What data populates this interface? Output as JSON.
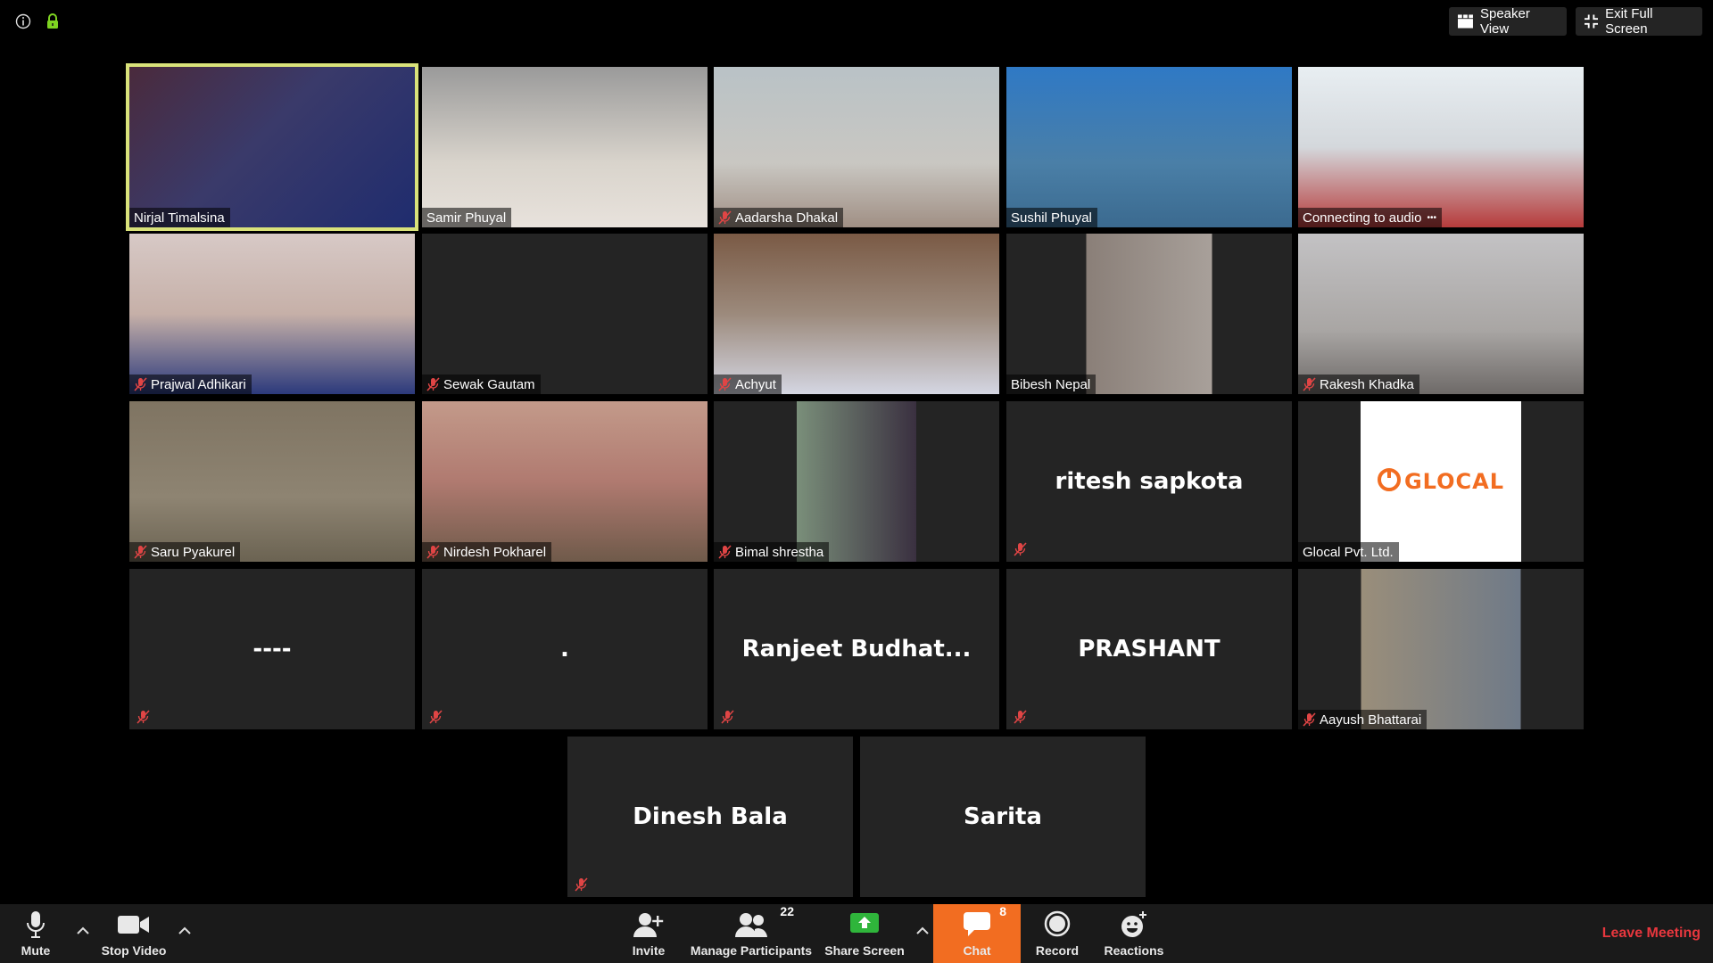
{
  "top": {
    "info_icon": "info-icon",
    "lock_icon": "lock-icon",
    "lock_color": "#7ed321",
    "speaker_view_label": "Speaker View",
    "exit_full_screen_label": "Exit Full Screen"
  },
  "tiles": [
    {
      "name": "Nirjal Timalsina",
      "muted": false,
      "active": true,
      "kind": "video"
    },
    {
      "name": "Samir Phuyal",
      "muted": false,
      "kind": "video"
    },
    {
      "name": "Aadarsha Dhakal",
      "muted": true,
      "kind": "video"
    },
    {
      "name": "Sushil Phuyal",
      "muted": false,
      "kind": "video"
    },
    {
      "name": "Connecting to audio",
      "status_suffix": "•••",
      "muted": false,
      "kind": "video"
    },
    {
      "name": "Prajwal Adhikari",
      "muted": true,
      "kind": "video"
    },
    {
      "name": "Sewak Gautam",
      "muted": true,
      "kind": "blank"
    },
    {
      "name": "Achyut",
      "muted": true,
      "kind": "video"
    },
    {
      "name": "Bibesh Nepal",
      "muted": false,
      "kind": "video"
    },
    {
      "name": "Rakesh Khadka",
      "muted": true,
      "kind": "video"
    },
    {
      "name": "Saru Pyakurel",
      "muted": true,
      "kind": "video"
    },
    {
      "name": "Nirdesh Pokharel",
      "muted": true,
      "kind": "video"
    },
    {
      "name": "Bimal shrestha",
      "muted": true,
      "kind": "video"
    },
    {
      "display": "ritesh sapkota",
      "muted": true,
      "kind": "name"
    },
    {
      "name": "Glocal Pvt. Ltd.",
      "muted": false,
      "kind": "logo",
      "logo_text": "GLOCAL",
      "logo_color": "#f26d21"
    },
    {
      "display": "----",
      "muted": true,
      "kind": "name"
    },
    {
      "display": ".",
      "muted": true,
      "kind": "name"
    },
    {
      "display": "Ranjeet  Budhat...",
      "muted": true,
      "kind": "name"
    },
    {
      "display": "PRASHANT",
      "muted": true,
      "kind": "name"
    },
    {
      "name": "Aayush Bhattarai",
      "muted": true,
      "kind": "video"
    },
    {
      "display": "Dinesh Bala",
      "muted": true,
      "kind": "name"
    },
    {
      "display": "Sarita",
      "muted": false,
      "kind": "name"
    }
  ],
  "toolbar": {
    "mute_label": "Mute",
    "stop_video_label": "Stop Video",
    "invite_label": "Invite",
    "manage_participants_label": "Manage Participants",
    "participants_count": "22",
    "share_screen_label": "Share Screen",
    "share_color": "#2fb53b",
    "chat_label": "Chat",
    "chat_count": "8",
    "chat_color": "#f26d21",
    "record_label": "Record",
    "reactions_label": "Reactions",
    "leave_label": "Leave Meeting",
    "leave_color": "#e8373e"
  }
}
